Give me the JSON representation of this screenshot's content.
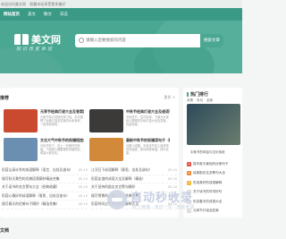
{
  "topbar": {
    "items": [
      "欢迎访问美文网",
      "收藏本站享受更多美好"
    ]
  },
  "nav": {
    "items": [
      "网站首页",
      "美文",
      "散文",
      "日志"
    ]
  },
  "banner": {
    "logo_text": "美文网",
    "slogan": "知识改变命运",
    "search_placeholder": "请输入您要搜索的内容",
    "search_button": "搜索文章"
  },
  "main": {
    "section_title": "推荐",
    "more": "更多 >",
    "cards": [
      {
        "title": "元宵节经典灯谜大全及答案集锦",
        "desc": "元宵节猜灯谜是传统习俗，本文整理了经典灯谜及答案供大家参考，一起来看看吧。",
        "color": "#c94a2e"
      },
      {
        "title": "中秋节经典灯谜大全及谜语答案精选",
        "desc": "中秋佳节，赏月猜谜，下面为大家精心整理的中秋灯谜大全及答案，欢迎阅读。",
        "color": "#3b3a38"
      },
      {
        "title": "文化大气中秋节的祝福短信合集精选",
        "desc": "中秋节到了，送上一份美好的祝福，下面是小编整理的祝福短信，希望大家喜欢。",
        "color": "#6a8fb0"
      },
      {
        "title": "最新中秋节的祝福语句子（精选合集）",
        "desc": "月圆人团圆，中秋佳节送上最真挚的祝福语，愿你阖家幸福，快乐安康。",
        "color": "#d28a3a"
      }
    ],
    "list_left": [
      {
        "t": "形容山清水秀的成语解释（语言、出处及造句）",
        "d": "05-10"
      },
      {
        "t": "描写秋天景色的优美段落摘抄精选合集",
        "d": "05-10"
      },
      {
        "t": "关于读书的名言警句大全（经典收藏）",
        "d": "05-10"
      },
      {
        "t": "形容心情好的成语解释（意思、出处及造句）",
        "d": "05-10"
      },
      {
        "t": "描写春天的优美句子摘抄（精选合集）",
        "d": "05-10"
      }
    ],
    "list_right": [
      {
        "t": "江河日下成语解释（意思、出处及造句）",
        "d": "05-10"
      },
      {
        "t": "形容友谊的成语大全及解释（精选）",
        "d": "05-10"
      },
      {
        "t": "关于坚持的励志名言警句摘抄",
        "d": "05-10"
      },
      {
        "t": "描写雪景的优美句子（经典合集）",
        "d": "05-10"
      },
      {
        "t": "形容时间过得快的成语解释大全",
        "d": "05-10"
      }
    ]
  },
  "sidebar": {
    "title": "热门排行",
    "tabs": [
      "本周",
      "本月",
      "全部"
    ],
    "hero_caption": "中秋节的风俗与文化传统",
    "rank": [
      "描写夏天景色的优美句子",
      "经典励志名言警句大全",
      "形容美好的成语解释",
      "关于读书的好词好句",
      "形容春天的成语大全",
      "元宵节灯谜及答案"
    ]
  },
  "watermark": {
    "big": "自动秒收录",
    "small": "收上链接 · 未访一次 · 自动收录"
  },
  "footer": {
    "title": "文档"
  }
}
